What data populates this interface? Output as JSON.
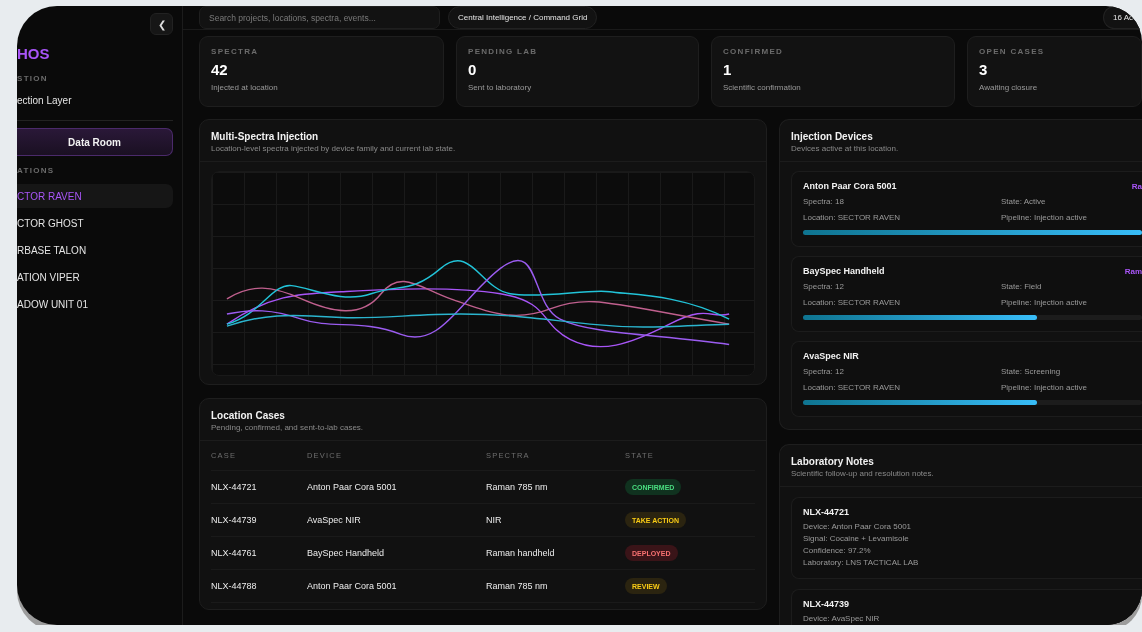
{
  "sidebar": {
    "collapse_button": "❮",
    "brand": "HOS",
    "section_label": "STION",
    "section_value": "ection Layer",
    "data_room_button": "Data Room",
    "locations_label": "ATIONS",
    "locations": [
      {
        "label": "CTOR RAVEN",
        "selected": true
      },
      {
        "label": "CTOR GHOST",
        "selected": false
      },
      {
        "label": "RBASE TALON",
        "selected": false
      },
      {
        "label": "ATION VIPER",
        "selected": false
      },
      {
        "label": "ADOW UNIT 01",
        "selected": false
      }
    ]
  },
  "topbar": {
    "search": {
      "placeholder": "Search projects, locations, spectra, events..."
    },
    "breadcrumb": "Central Intelligence / Command Grid",
    "right_pill": "16 Ac"
  },
  "stats": [
    {
      "label": "SPECTRA",
      "value": "42",
      "caption": "Injected at location"
    },
    {
      "label": "PENDING LAB",
      "value": "0",
      "caption": "Sent to laboratory"
    },
    {
      "label": "CONFIRMED",
      "value": "1",
      "caption": "Scientific confirmation"
    },
    {
      "label": "OPEN CASES",
      "value": "3",
      "caption": "Awaiting closure"
    }
  ],
  "injection_chart": {
    "title": "Multi-Spectra Injection",
    "subtitle": "Location-level spectra injected by device family and current lab state."
  },
  "cases": {
    "title": "Location Cases",
    "subtitle": "Pending, confirmed, and sent-to-lab cases.",
    "columns": [
      "CASE",
      "DEVICE",
      "SPECTRA",
      "STATE"
    ],
    "rows": [
      {
        "case": "NLX-44721",
        "device": "Anton Paar Cora 5001",
        "spectra": "Raman 785 nm",
        "state": {
          "label": "CONFIRMED",
          "kind": "success"
        }
      },
      {
        "case": "NLX-44739",
        "device": "AvaSpec NIR",
        "spectra": "NIR",
        "state": {
          "label": "TAKE ACTION",
          "kind": "warning"
        }
      },
      {
        "case": "NLX-44761",
        "device": "BaySpec Handheld",
        "spectra": "Raman handheld",
        "state": {
          "label": "DEPLOYED",
          "kind": "danger"
        }
      },
      {
        "case": "NLX-44788",
        "device": "Anton Paar Cora 5001",
        "spectra": "Raman 785 nm",
        "state": {
          "label": "REVIEW",
          "kind": "warning"
        }
      }
    ]
  },
  "devices": {
    "title": "Injection Devices",
    "subtitle": "Devices active at this location.",
    "items": [
      {
        "name": "Anton Paar Cora 5001",
        "tag": "Ra",
        "spectra": "Spectra: 18",
        "state": "State: Active",
        "location": "Location: SECTOR RAVEN",
        "pipeline": "Pipeline: Injection active",
        "level": 1
      },
      {
        "name": "BaySpec Handheld",
        "tag": "Ram",
        "spectra": "Spectra: 12",
        "state": "State: Field",
        "location": "Location: SECTOR RAVEN",
        "pipeline": "Pipeline: Injection active",
        "level": 0.69
      },
      {
        "name": "AvaSpec NIR",
        "spectra": "Spectra: 12",
        "state": "State: Screening",
        "location": "Location: SECTOR RAVEN",
        "pipeline": "Pipeline: Injection active",
        "level": 0.69
      }
    ]
  },
  "lab_notes": {
    "title": "Laboratory Notes",
    "subtitle": "Scientific follow-up and resolution notes.",
    "notes": [
      {
        "case": "NLX-44721",
        "lines": [
          "Device: Anton Paar Cora 5001",
          "Signal: Cocaine + Levamisole",
          "Confidence: 97.2%",
          "Laboratory: LNS TACTICAL LAB"
        ]
      },
      {
        "case": "NLX-44739",
        "lines": [
          "Device: AvaSpec NIR"
        ]
      }
    ]
  }
}
